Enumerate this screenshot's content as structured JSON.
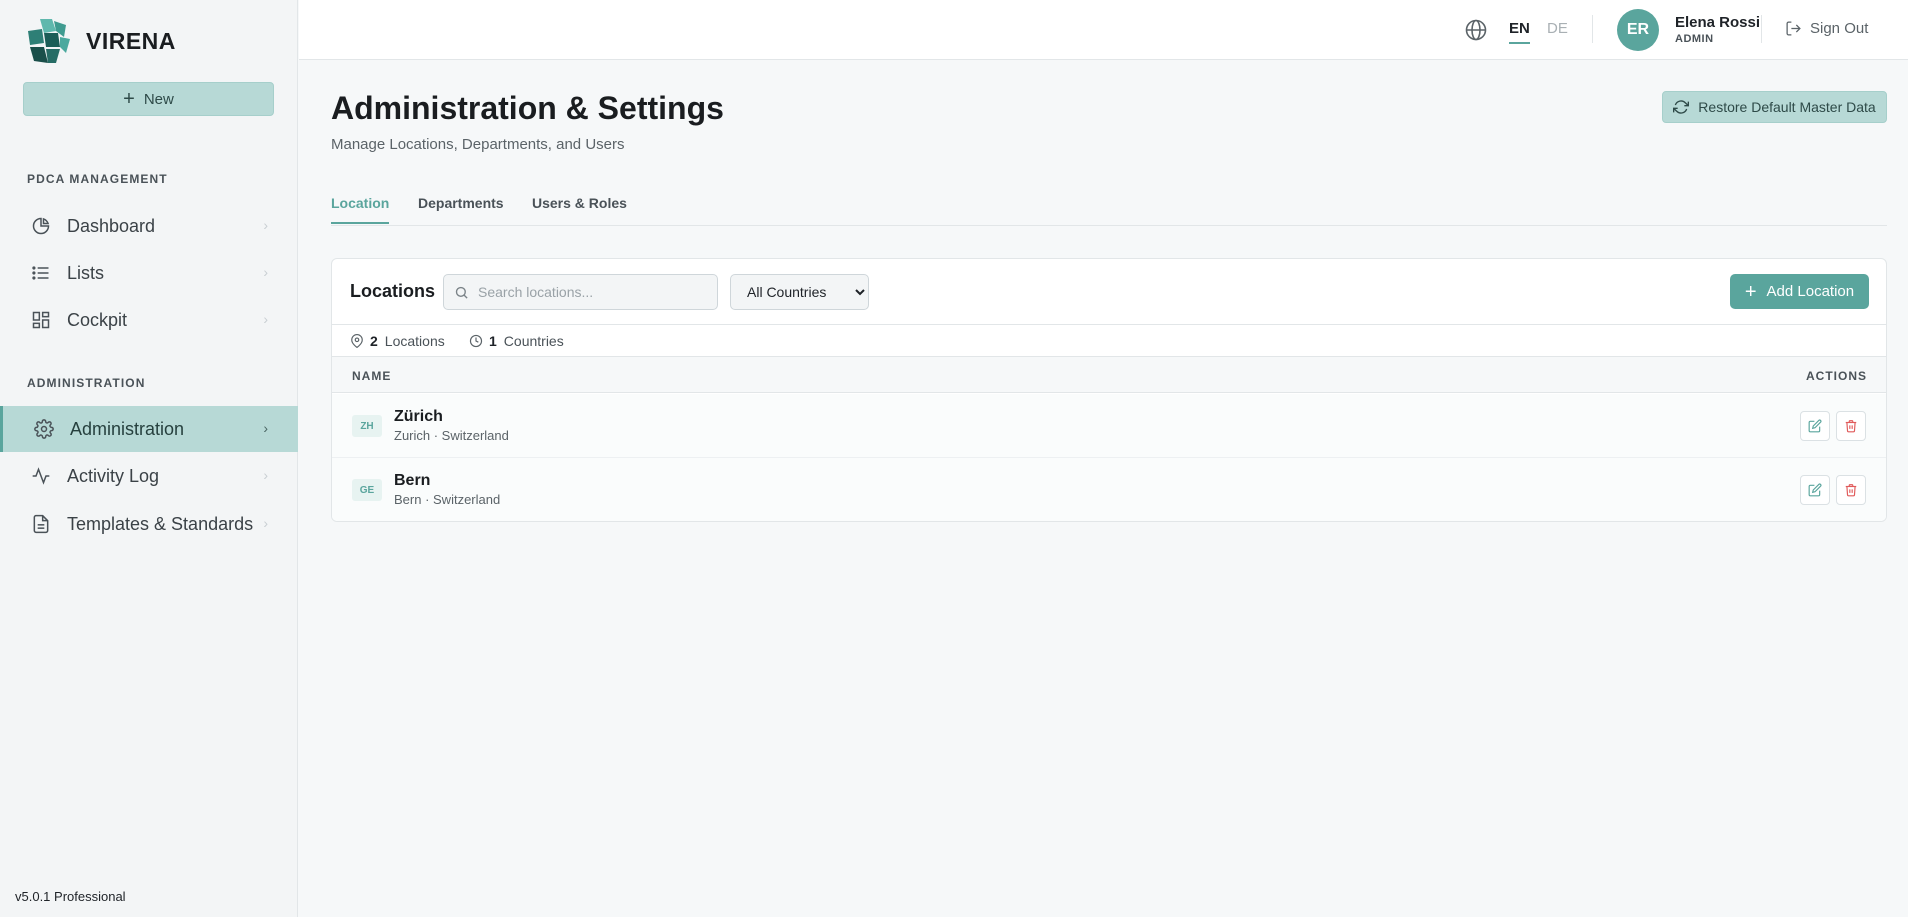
{
  "brand": {
    "name": "VIRENA"
  },
  "sidebar": {
    "new_label": "New",
    "sections": [
      {
        "label": "PDCA MANAGEMENT"
      },
      {
        "label": "ADMINISTRATION"
      }
    ],
    "items": [
      {
        "label": "Dashboard",
        "icon": "pie-chart-icon"
      },
      {
        "label": "Lists",
        "icon": "list-icon"
      },
      {
        "label": "Cockpit",
        "icon": "grid-icon"
      },
      {
        "label": "Administration",
        "icon": "gear-icon",
        "active": true
      },
      {
        "label": "Activity Log",
        "icon": "activity-icon"
      },
      {
        "label": "Templates & Standards",
        "icon": "document-icon"
      }
    ],
    "version": "v5.0.1 Professional"
  },
  "topbar": {
    "languages": [
      "EN",
      "DE"
    ],
    "active_language": "EN",
    "user": {
      "initials": "ER",
      "name": "Elena Rossi",
      "role": "ADMIN"
    },
    "signout_label": "Sign Out"
  },
  "page": {
    "title": "Administration & Settings",
    "subtitle": "Manage Locations, Departments, and Users",
    "restore_label": "Restore Default Master Data",
    "tabs": [
      {
        "label": "Location",
        "active": true
      },
      {
        "label": "Departments"
      },
      {
        "label": "Users & Roles"
      }
    ]
  },
  "locations": {
    "title": "Locations",
    "search_placeholder": "Search locations...",
    "country_filter": {
      "selected": "All Countries",
      "options": [
        "All Countries"
      ]
    },
    "add_label": "Add Location",
    "stats": {
      "locations_count": "2",
      "locations_label": "Locations",
      "countries_count": "1",
      "countries_label": "Countries"
    },
    "columns": {
      "name": "NAME",
      "actions": "ACTIONS"
    },
    "rows": [
      {
        "code": "ZH",
        "name": "Zürich",
        "sub": "Zurich · Switzerland"
      },
      {
        "code": "GE",
        "name": "Bern",
        "sub": "Bern · Switzerland"
      }
    ]
  },
  "colors": {
    "accent": "#5aa59d",
    "accent_light": "#b7d9d6",
    "danger": "#e05a5a"
  }
}
